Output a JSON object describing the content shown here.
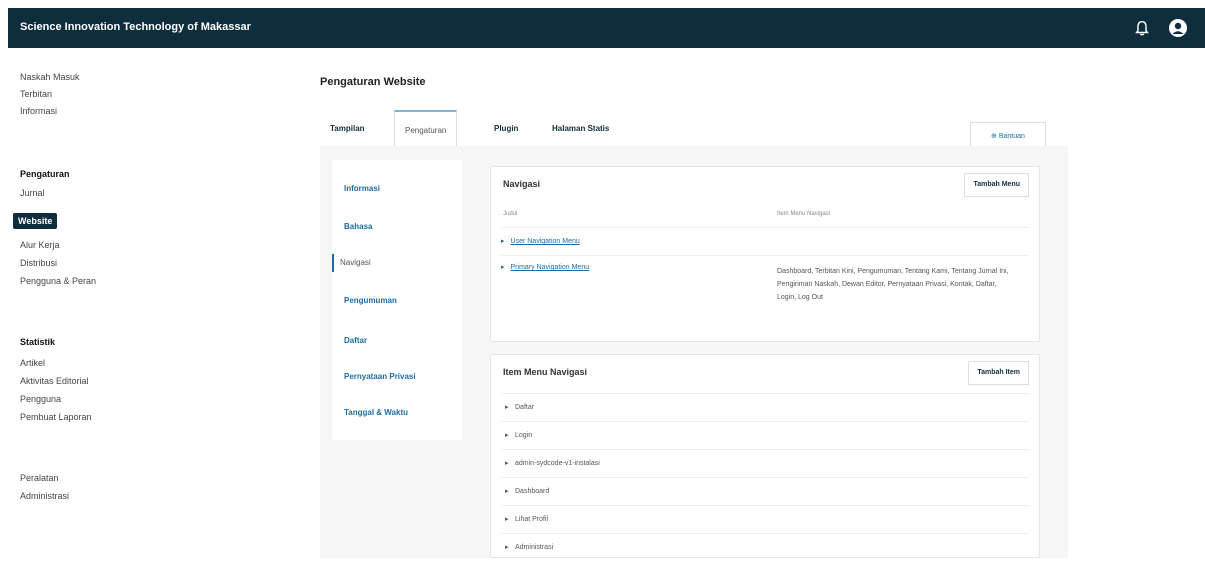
{
  "header": {
    "site_title": "Science Innovation Technology of Makassar"
  },
  "sidebar": {
    "group1": [
      "Naskah Masuk",
      "Terbitan",
      "Informasi"
    ],
    "group2_title": "Pengaturan",
    "group2": [
      "Jurnal",
      "Website",
      "Alur Kerja",
      "Distribusi",
      "Pengguna & Peran"
    ],
    "group2_active_index": 1,
    "group3_title": "Statistik",
    "group3": [
      "Artikel",
      "Aktivitas Editorial",
      "Pengguna",
      "Pembuat Laporan"
    ],
    "group4": [
      "Peralatan",
      "Administrasi"
    ]
  },
  "page": {
    "title": "Pengaturan Website",
    "tabs": [
      "Tampilan",
      "Pengaturan",
      "Plugin",
      "Halaman Statis"
    ],
    "active_tab": "Pengaturan",
    "help_label": "⊕ Bantuan"
  },
  "subnav": [
    "Informasi",
    "Bahasa",
    "Navigasi",
    "Pengumuman",
    "Daftar",
    "Pernyataan Privasi",
    "Tanggal & Waktu"
  ],
  "navigation_card": {
    "title": "Navigasi",
    "add_button": "Tambah Menu",
    "col_title": "Judul",
    "col_items": "Item Menu Navigasi",
    "menus": [
      "User Navigation Menu",
      "Primary Navigation Menu"
    ],
    "primary_items_text": "Dashboard, Terbitan Kini, Pengumuman, Tentang Kami, Tentang Jurnal Ini, Pengiriman Naskah, Dewan Editor, Pernyataan Privasi, Kontak, Daftar, Login, Log Out"
  },
  "items_card": {
    "title": "Item Menu Navigasi",
    "add_button": "Tambah Item",
    "items": [
      "Daftar",
      "Login",
      "admin-sydcode-v1-instalasi",
      "Dashboard",
      "Lihat Profil",
      "Administrasi"
    ]
  }
}
